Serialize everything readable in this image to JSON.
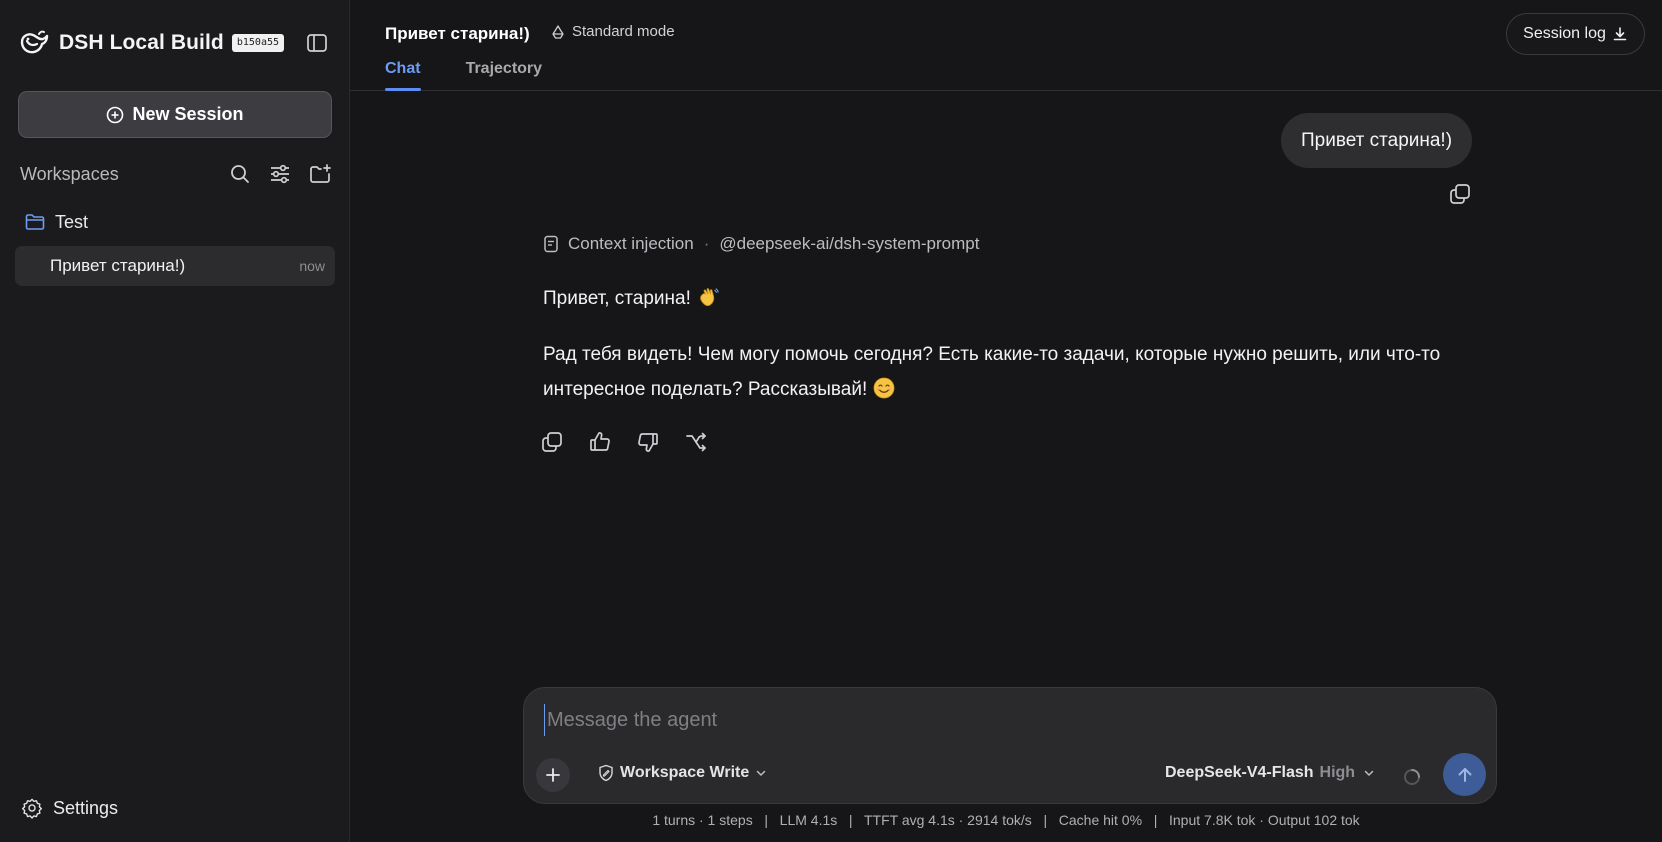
{
  "sidebar": {
    "brand_name": "DSH Local Build",
    "build_badge": "b150a55",
    "new_session_label": "New Session",
    "workspaces_label": "Workspaces",
    "folder_name": "Test",
    "session": {
      "title": "Привет старина!)",
      "time": "now"
    },
    "settings_label": "Settings"
  },
  "header": {
    "title": "Привет старина!)",
    "mode_label": "Standard mode",
    "tabs": [
      {
        "label": "Chat",
        "active": true
      },
      {
        "label": "Trajectory",
        "active": false
      }
    ],
    "session_log_label": "Session log"
  },
  "conversation": {
    "user_message": "Привет старина!)",
    "context_label": "Context injection",
    "context_source": "@deepseek-ai/dsh-system-prompt",
    "assistant_paragraph_1": "Привет, старина!",
    "assistant_paragraph_2": "Рад тебя видеть! Чем могу помочь сегодня? Есть какие-то задачи, которые нужно решить, или что-то интересное поделать? Рассказывай!"
  },
  "composer": {
    "placeholder": "Message the agent",
    "permission_label": "Workspace Write",
    "model_name": "DeepSeek-V4-Flash",
    "model_level": "High"
  },
  "stats_line": "1 turns · 1 steps   |   LLM 4.1s   |   TTFT avg 4.1s · 2914 tok/s   |   Cache hit 0%   |   Input 7.8K tok · Output 102 tok",
  "colors": {
    "accent": "#6d9cf2",
    "send_button": "#3d5c98",
    "folder_icon": "#6d9cf2"
  }
}
